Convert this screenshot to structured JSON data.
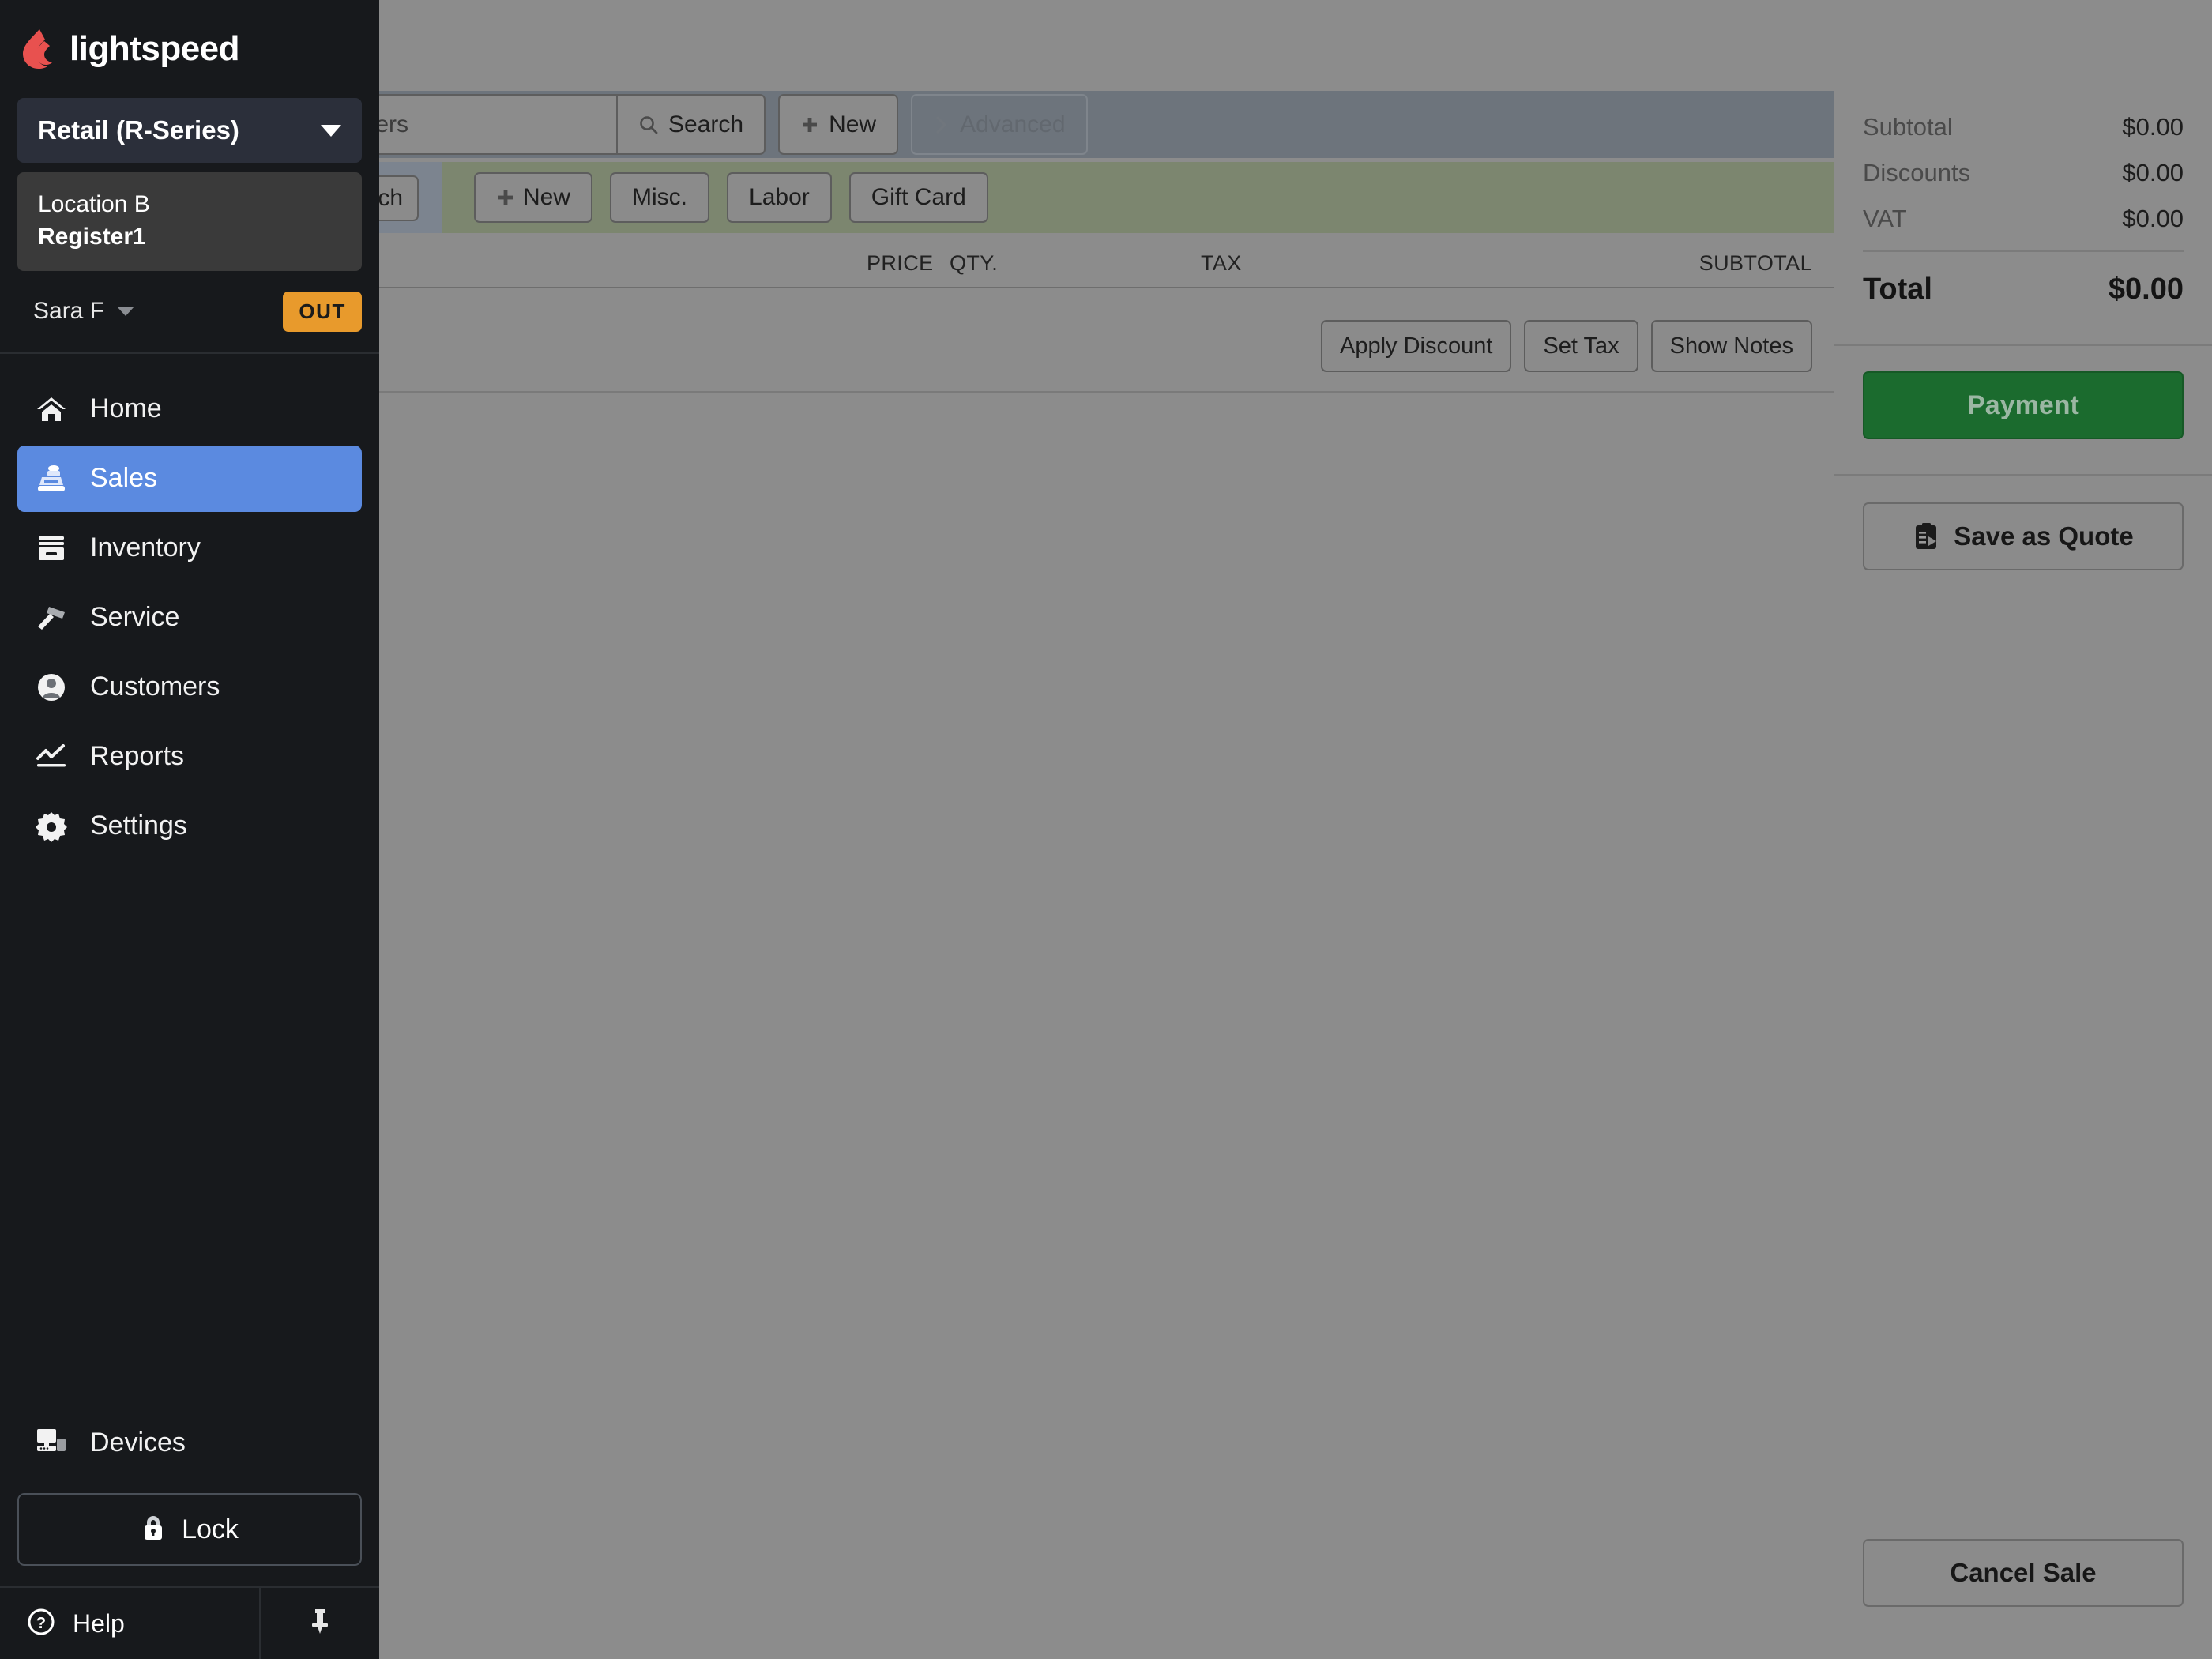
{
  "brand": {
    "name": "lightspeed",
    "logo_color": "#e8514f"
  },
  "sidebar": {
    "product_selector": {
      "label": "Retail (R-Series)",
      "icon": "chevron-down-icon"
    },
    "register": {
      "location": "Location B",
      "register": "Register1"
    },
    "user": {
      "name": "Sara F",
      "status_badge": "OUT",
      "badge_color": "#e89a2c"
    },
    "nav_items": [
      {
        "label": "Home",
        "icon": "home-icon",
        "active": false
      },
      {
        "label": "Sales",
        "icon": "cash-register-icon",
        "active": true
      },
      {
        "label": "Inventory",
        "icon": "inventory-box-icon",
        "active": false
      },
      {
        "label": "Service",
        "icon": "hammer-icon",
        "active": false
      },
      {
        "label": "Customers",
        "icon": "user-circle-icon",
        "active": false
      },
      {
        "label": "Reports",
        "icon": "line-chart-icon",
        "active": false
      },
      {
        "label": "Settings",
        "icon": "gear-icon",
        "active": false
      }
    ],
    "devices": {
      "label": "Devices",
      "icon": "monitor-icon"
    },
    "lock": {
      "label": "Lock",
      "icon": "lock-icon"
    },
    "help": {
      "label": "Help",
      "icon": "question-circle-icon"
    },
    "pin": {
      "icon": "pin-icon"
    },
    "active_accent": "#5b8ae0"
  },
  "toolbar": {
    "search": {
      "placeholder": "Customers",
      "value": ""
    },
    "search_button": {
      "label": "Search",
      "icon": "search-icon"
    },
    "new_button": {
      "label": "New",
      "icon": "plus-icon"
    },
    "advanced_button": {
      "label": "Advanced",
      "icon": "chevron-right-icon"
    }
  },
  "actionbar": {
    "partial_button": {
      "label": "ch"
    },
    "buttons": [
      {
        "label": "New",
        "icon": "plus-icon"
      },
      {
        "label": "Misc.",
        "icon": ""
      },
      {
        "label": "Labor",
        "icon": ""
      },
      {
        "label": "Gift Card",
        "icon": ""
      }
    ],
    "section_color": "#7c866f"
  },
  "cart": {
    "columns": [
      "PRICE",
      "QTY.",
      "TAX",
      "SUBTOTAL"
    ],
    "rows": [],
    "row_actions": [
      {
        "label": "Apply Discount"
      },
      {
        "label": "Set Tax"
      },
      {
        "label": "Show Notes"
      }
    ]
  },
  "summary": {
    "lines": [
      {
        "label": "Subtotal",
        "value": "$0.00"
      },
      {
        "label": "Discounts",
        "value": "$0.00"
      },
      {
        "label": "VAT",
        "value": "$0.00"
      }
    ],
    "total": {
      "label": "Total",
      "value": "$0.00"
    },
    "payment_button": {
      "label": "Payment",
      "color": "#1b6b2e"
    },
    "save_quote_button": {
      "label": "Save as Quote",
      "icon": "clipboard-icon"
    },
    "cancel_button": {
      "label": "Cancel Sale"
    }
  }
}
